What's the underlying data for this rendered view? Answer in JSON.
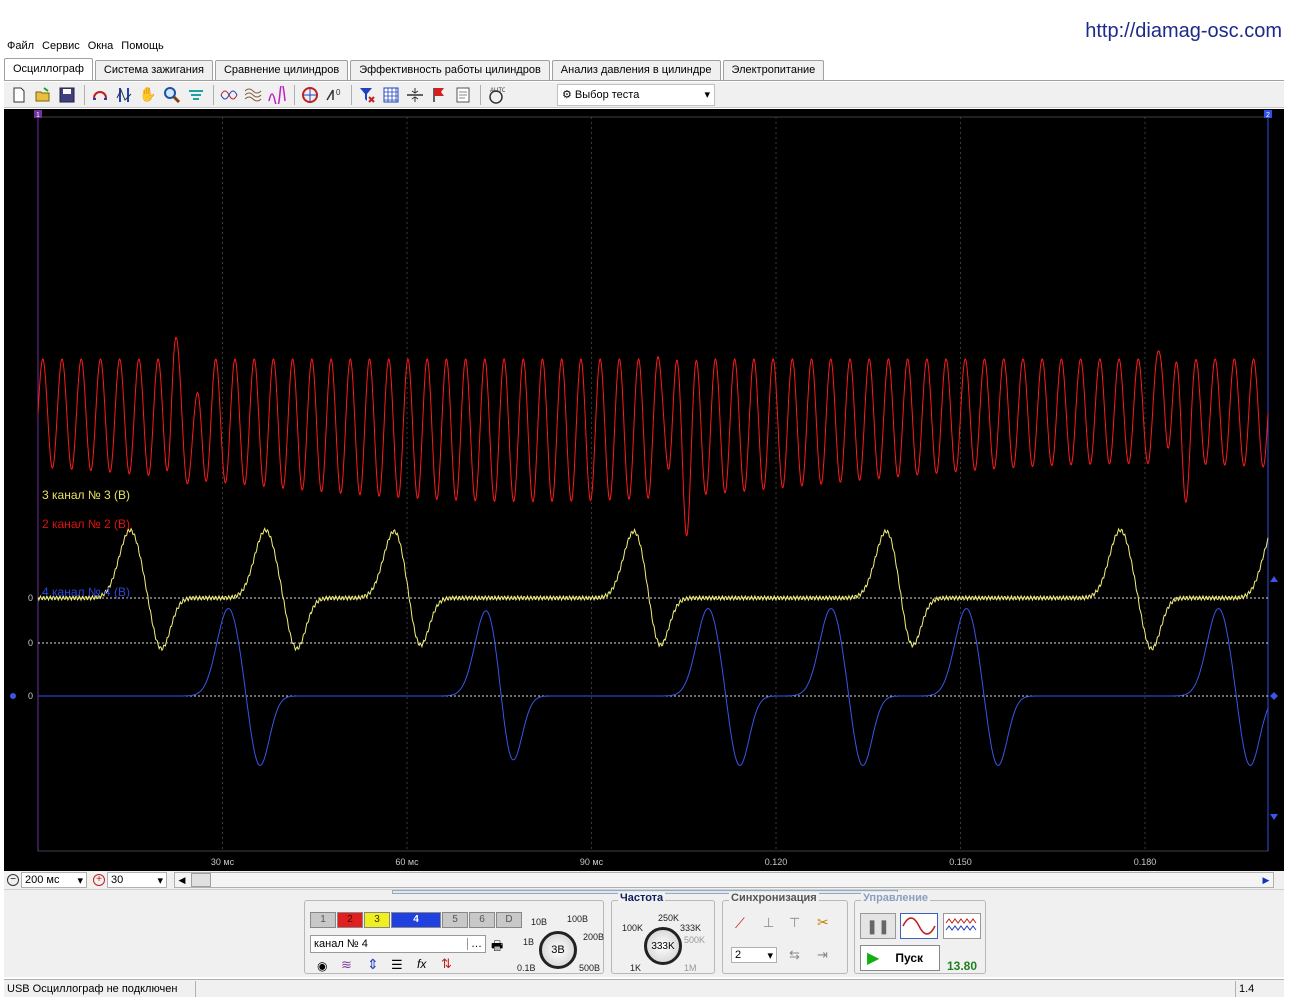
{
  "site_url": "http://diamag-osc.com",
  "menu": [
    "Файл",
    "Сервис",
    "Окна",
    "Помощь"
  ],
  "tabs": [
    {
      "label": "Осциллограф",
      "active": true
    },
    {
      "label": "Система зажигания",
      "active": false
    },
    {
      "label": "Сравнение цилиндров",
      "active": false
    },
    {
      "label": "Эффективность работы цилиндров",
      "active": false
    },
    {
      "label": "Анализ давления в цилиндре",
      "active": false
    },
    {
      "label": "Электропитание",
      "active": false
    }
  ],
  "toolbar": {
    "test_select": "Выбор теста",
    "icons": [
      "new-file-icon",
      "open-file-icon",
      "save-icon",
      "cursor-reset-icon",
      "measure-cursor-icon",
      "hand-pan-icon",
      "zoom-icon",
      "signal-filter-icon",
      "waveform-compare-icon",
      "waveform-overlay-icon",
      "spectrum-icon",
      "auto-scale-icon",
      "zero-offset-icon",
      "channel-filter-icon",
      "grid-icon",
      "horizontal-cursor-icon",
      "marker-flag-icon",
      "notes-icon",
      "auto-icon"
    ]
  },
  "scope": {
    "background": "#000000",
    "channel_labels": [
      {
        "text": "3 канал № 3 (В)",
        "color": "#e8e060"
      },
      {
        "text": "2 канал № 2 (В)",
        "color": "#e01010"
      },
      {
        "text": "4 канал № 4 (В)",
        "color": "#2a45d8"
      }
    ],
    "zero_labels": [
      "0",
      "0",
      "0"
    ],
    "cursor_markers": [
      "1",
      "2"
    ]
  },
  "chart_data": {
    "type": "line",
    "x_unit": "s",
    "xlim": [
      0.0,
      0.2
    ],
    "x_ticks": [
      "30 мс",
      "60 мс",
      "90 мс",
      "0.120",
      "0.150",
      "0.180"
    ],
    "series": [
      {
        "name": "канал № 2 (В)",
        "color": "#ff1a1a",
        "kind": "high-frequency oscillation",
        "cycles": 64,
        "spike_x": [
          0.022,
          0.102,
          0.183
        ]
      },
      {
        "name": "канал № 3 (В)",
        "color": "#f2f07a",
        "kind": "periodic pulse",
        "peaks_x": [
          0.015,
          0.037,
          0.058,
          0.097,
          0.138,
          0.176,
          0.201
        ],
        "troughs_x": [
          0.02,
          0.042,
          0.062,
          0.101,
          0.142,
          0.181
        ]
      },
      {
        "name": "канал № 4 (В)",
        "color": "#3a55e8",
        "kind": "periodic bipolar pulse",
        "peaks_x": [
          0.031,
          0.073,
          0.109,
          0.129,
          0.151,
          0.192
        ],
        "troughs_x": [
          0.036,
          0.077,
          0.114,
          0.134,
          0.156,
          0.197
        ]
      }
    ]
  },
  "timebase": {
    "value": "200 мс",
    "zoom": "30"
  },
  "channels": {
    "buttons": [
      "1",
      "2",
      "3",
      "4",
      "5",
      "6",
      "D"
    ],
    "active": "4",
    "name": "канал № 4",
    "volt_labels": [
      "10В",
      "100В",
      "1В",
      "200В",
      "0.1В",
      "500В"
    ],
    "volt_value": "3В"
  },
  "frequency": {
    "title": "Частота",
    "labels": [
      "250K",
      "100K",
      "333K",
      "500K",
      "1K",
      "1M"
    ],
    "value": "333K"
  },
  "sync": {
    "title": "Синхронизация",
    "value": "2"
  },
  "control": {
    "title": "Управление",
    "start_label": "Пуск",
    "voltage": "13.80"
  },
  "status": {
    "text": "USB Осциллограф не подключен",
    "version": "1.4"
  }
}
